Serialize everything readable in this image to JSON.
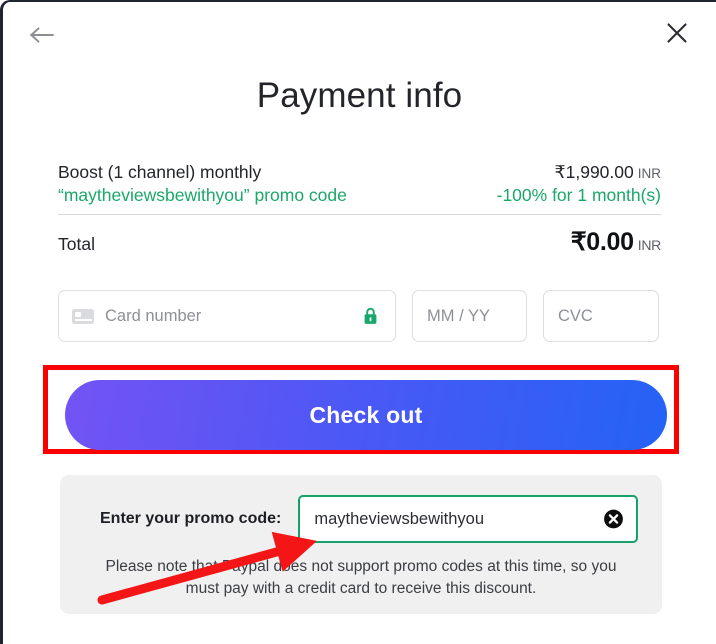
{
  "header": {
    "back_icon": "arrow-left-icon",
    "close_icon": "close-icon",
    "title": "Payment info"
  },
  "summary": {
    "rows": [
      {
        "label": "Boost (1 channel) monthly",
        "amount": "₹1,990.00",
        "currency": "INR"
      },
      {
        "label": "“maytheviewsbewithyou” promo code",
        "amount": "-100% for 1 month(s)",
        "currency": ""
      }
    ],
    "total": {
      "label": "Total",
      "amount": "₹0.00",
      "currency": "INR"
    }
  },
  "payment_fields": {
    "card_number": {
      "placeholder": "Card number",
      "value": "",
      "card_icon": "credit-card-icon",
      "lock_icon": "lock-icon"
    },
    "expiry": {
      "placeholder": "MM / YY",
      "value": ""
    },
    "cvc": {
      "placeholder": "CVC",
      "value": ""
    }
  },
  "checkout": {
    "label": "Check out",
    "gradient_start": "#7354f4",
    "gradient_end": "#2463f5",
    "highlight_color": "#fb0000"
  },
  "promo": {
    "label": "Enter your promo code:",
    "value": "maytheviewsbewithyou",
    "placeholder": "Promo code",
    "clear_icon": "clear-circle-icon",
    "border_color": "#16a06a",
    "note": "Please note that Paypal does not support promo codes at this time, so you must pay with a credit card to receive this discount."
  },
  "annotation": {
    "arrow_color": "#f41616"
  }
}
